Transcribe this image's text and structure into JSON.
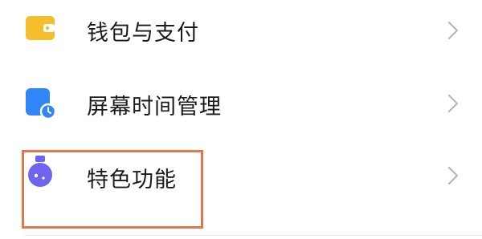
{
  "settings": {
    "items": [
      {
        "label": "钱包与支付",
        "icon": "wallet-icon",
        "icon_color": "#F5BE2E"
      },
      {
        "label": "屏幕时间管理",
        "icon": "screen-time-icon",
        "icon_color": "#2F86F6"
      },
      {
        "label": "特色功能",
        "icon": "flask-icon",
        "icon_color": "#6E64F0"
      }
    ],
    "chevron_icon": "chevron-right-icon"
  },
  "highlight": {
    "target": "特色功能",
    "color": "#E8744A"
  }
}
